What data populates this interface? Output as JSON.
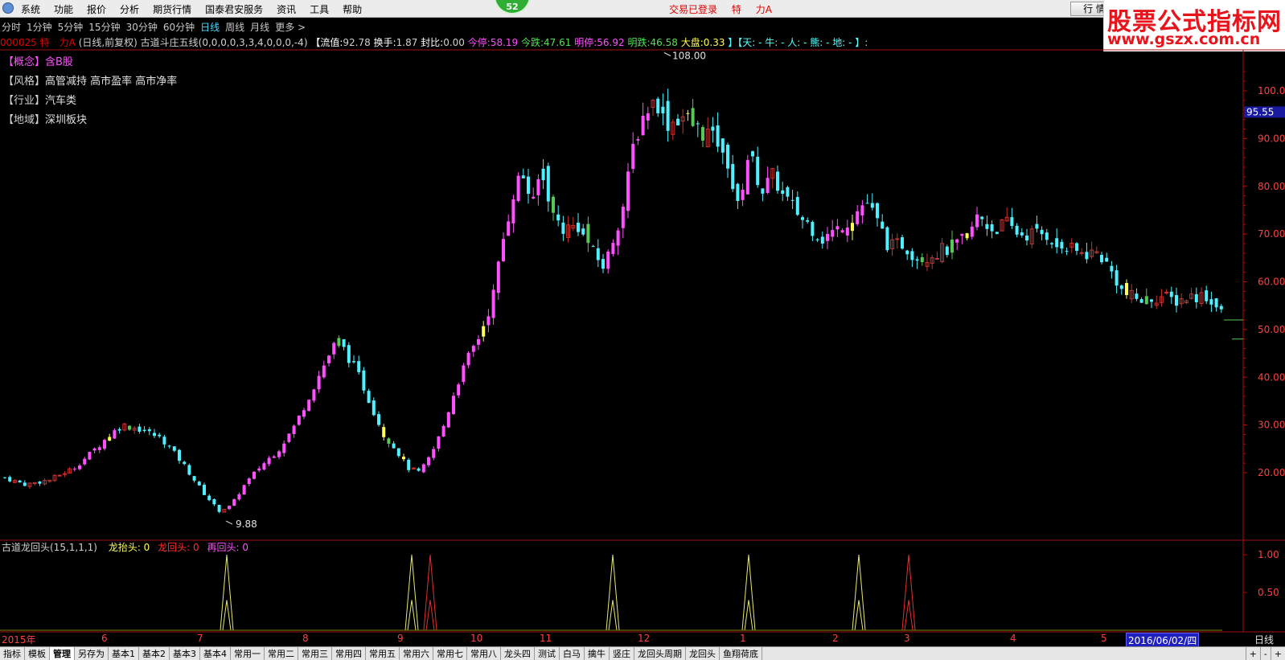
{
  "menu": {
    "items": [
      "系统",
      "功能",
      "报价",
      "分析",
      "期货行情",
      "国泰君安服务",
      "资讯",
      "工具",
      "帮助"
    ],
    "badge": "52",
    "status": [
      "交易已登录",
      "特",
      "力A"
    ],
    "quote_button": "行 情"
  },
  "brand": {
    "title": "股票公式指标网",
    "url": "www.gszx.com.cn"
  },
  "periods": {
    "items": [
      "分时",
      "1分钟",
      "5分钟",
      "15分钟",
      "30分钟",
      "60分钟",
      "日线",
      "周线",
      "月线",
      "更多 >"
    ],
    "active": "日线"
  },
  "info": {
    "code": "000025",
    "name": "特　力A",
    "desc": "(日线,前复权) 古道斗庄五线(0,0,0,0,3,3,4,0,0,0,-4)",
    "stats": [
      {
        "label": "【流值:",
        "value": "92.78",
        "color": "white"
      },
      {
        "label": "换手:",
        "value": "1.87",
        "color": "white"
      },
      {
        "label": "封比:",
        "value": "0.00",
        "color": "white"
      },
      {
        "label": "今停:",
        "value": "58.19",
        "color": "mag"
      },
      {
        "label": "今跌:",
        "value": "47.61",
        "color": "grn"
      },
      {
        "label": "明停:",
        "value": "56.92",
        "color": "mag"
      },
      {
        "label": "明跌:",
        "value": "46.58",
        "color": "grn"
      },
      {
        "label": "大盘:",
        "value": "0.33",
        "color": "white"
      }
    ],
    "tail": "】【天: - 牛: - 人: - 熊: - 地: - 】:"
  },
  "tags": [
    {
      "key": "【概念】",
      "value": "含B股",
      "color": "magenta"
    },
    {
      "key": "【风格】",
      "value": "高管减持 高市盈率 高市净率",
      "color": "white"
    },
    {
      "key": "【行业】",
      "value": "汽车类",
      "color": "white"
    },
    {
      "key": "【地域】",
      "value": "深圳板块",
      "color": "white"
    }
  ],
  "main_chart": {
    "high_label": "108.00",
    "low_label": "9.88",
    "current_price": "95.55",
    "y_ticks": [
      "100.0",
      "90.00",
      "80.00",
      "70.00",
      "60.00",
      "50.00",
      "40.00",
      "30.00",
      "20.00"
    ],
    "colors": {
      "up": "#ff50ff",
      "down": "#4ff0ff",
      "yang": "#c83232",
      "yin": "#ff3030",
      "axis": "#a01010"
    }
  },
  "sub_chart": {
    "title": "古道龙回头(15,1,1,1)",
    "labels": [
      {
        "text": "龙抬头: 0",
        "color": "yellow"
      },
      {
        "text": "龙回头: 0",
        "color": "red"
      },
      {
        "text": "再回头: 0",
        "color": "magenta"
      }
    ],
    "y_ticks": [
      "1.00",
      "0.50"
    ]
  },
  "chart_data": [
    {
      "type": "candlestick",
      "title": "古道斗庄五线",
      "ylim": [
        10,
        108
      ],
      "x_ticks": [
        "2015年",
        "6",
        "7",
        "8",
        "9",
        "10",
        "11",
        "12",
        "1",
        "2",
        "3",
        "4",
        "5"
      ],
      "y_ticks": [
        20,
        30,
        40,
        50,
        60,
        70,
        80,
        90,
        100
      ],
      "highest": 108.0,
      "lowest": 9.88,
      "last": 95.55,
      "series": [
        {
          "name": "close_approx",
          "x": [
            "2015-05",
            "2015-06",
            "2015-07",
            "2015-08",
            "2015-09",
            "2015-10",
            "2015-11",
            "2015-12",
            "2016-01",
            "2016-02",
            "2016-03",
            "2016-04",
            "2016-05",
            "2016-06"
          ],
          "values": [
            19,
            29,
            12,
            48,
            20,
            45,
            70,
            92,
            80,
            70,
            64,
            71,
            66,
            52
          ]
        }
      ]
    },
    {
      "type": "line",
      "title": "古道龙回头(15,1,1,1)",
      "ylim": [
        0,
        1
      ],
      "series": [
        {
          "name": "龙抬头",
          "values": [
            0,
            0,
            0,
            0,
            0,
            0,
            0,
            0,
            0,
            0,
            0,
            0,
            0,
            0
          ]
        },
        {
          "name": "龙回头",
          "values": [
            0,
            0,
            0,
            0,
            0,
            0,
            0,
            0,
            0,
            0,
            0,
            0,
            0,
            0
          ]
        },
        {
          "name": "再回头",
          "values": [
            0,
            0,
            0,
            0,
            0,
            0,
            0,
            0,
            0,
            0,
            0,
            0,
            0,
            0
          ]
        }
      ],
      "spikes": [
        {
          "date": "2015-07",
          "series": "龙抬头"
        },
        {
          "date": "2015-09a",
          "series": "龙抬头"
        },
        {
          "date": "2015-09b",
          "series": "龙回头"
        },
        {
          "date": "2015-11",
          "series": "龙抬头"
        },
        {
          "date": "2016-01",
          "series": "龙抬头"
        },
        {
          "date": "2016-02",
          "series": "龙抬头"
        },
        {
          "date": "2016-03",
          "series": "龙回头"
        }
      ]
    }
  ],
  "x_axis": {
    "labels": [
      "2015年",
      "6",
      "7",
      "8",
      "9",
      "10",
      "11",
      "12",
      "1",
      "2",
      "3",
      "4",
      "5"
    ],
    "date": "2016/06/02/四",
    "period": "日线"
  },
  "tabs": {
    "items": [
      "指标",
      "模板",
      "管理",
      "另存为",
      "基本1",
      "基本2",
      "基本3",
      "基本4",
      "常用一",
      "常用二",
      "常用三",
      "常用四",
      "常用五",
      "常用六",
      "常用七",
      "常用八",
      "龙头四",
      "测试",
      "白马",
      "擒牛",
      "竖庄",
      "龙回头周期",
      "龙回头",
      "鱼翔荷底"
    ],
    "active": "管理",
    "controls": [
      "+",
      "-",
      "+"
    ]
  }
}
